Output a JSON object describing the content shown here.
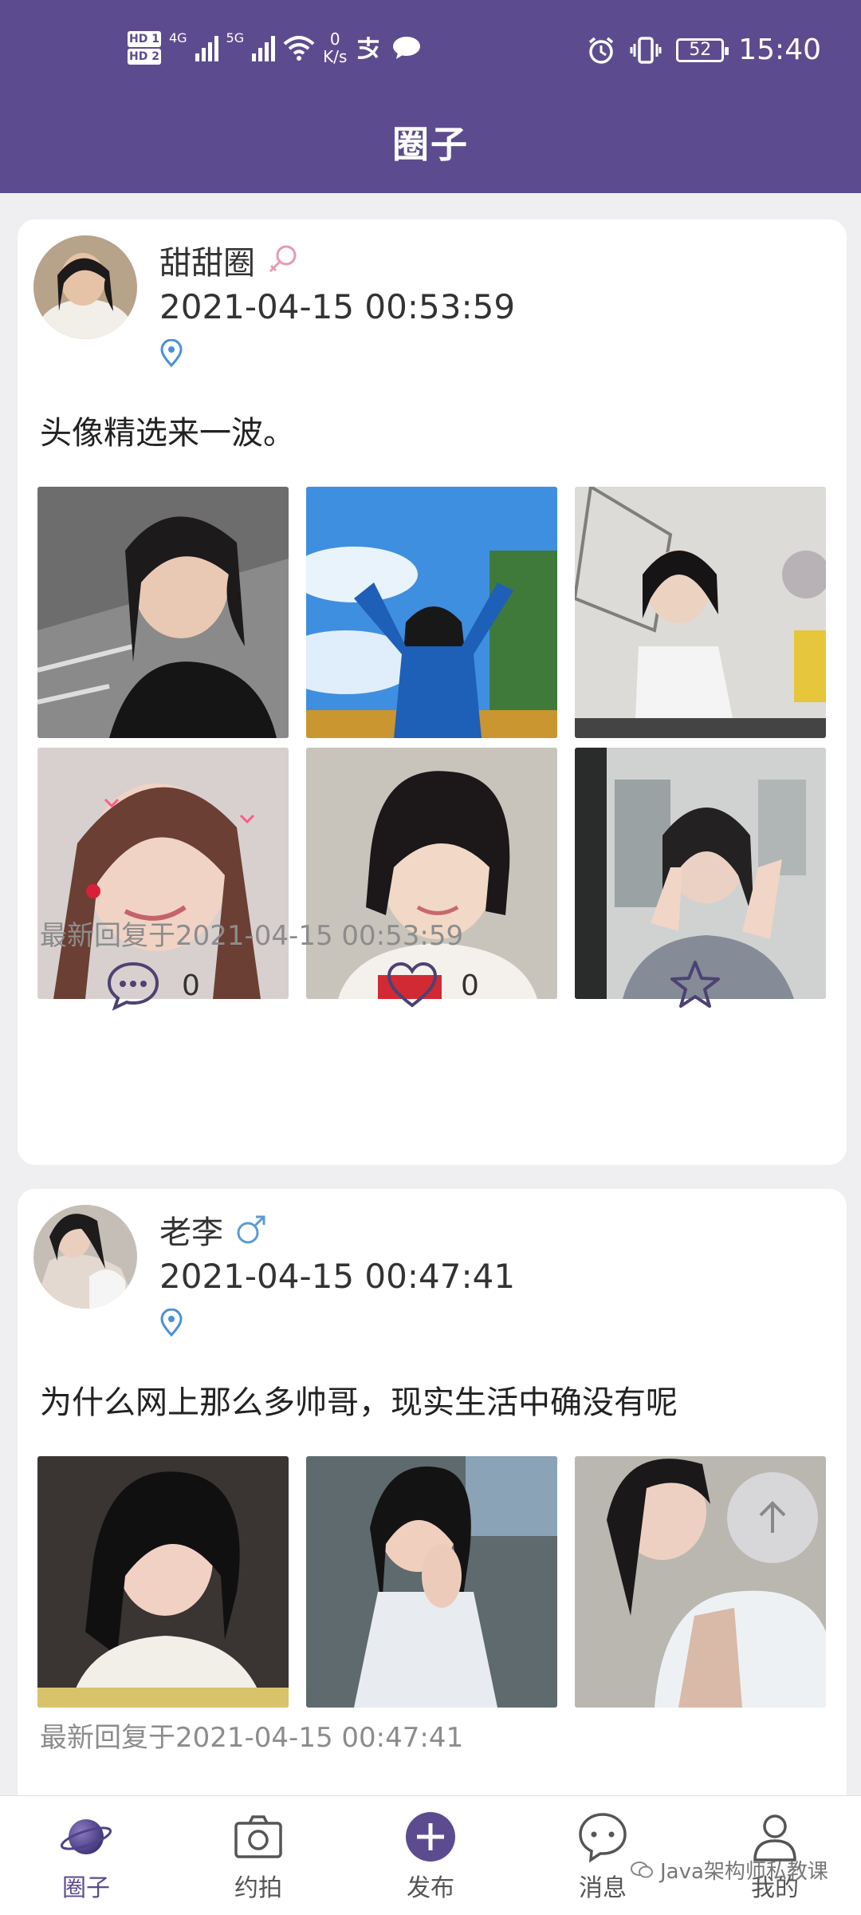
{
  "status_bar": {
    "speed_value": "0",
    "speed_unit": "K/s",
    "battery": "52",
    "time": "15:40",
    "hd1": "HD 1",
    "hd2": "HD 2",
    "net1": "4G",
    "net2": "5G"
  },
  "header": {
    "title": "圈子"
  },
  "posts": [
    {
      "username": "甜甜圈",
      "gender": "female",
      "time": "2021-04-15 00:53:59",
      "text": "头像精选来一波。",
      "reply_time": "最新回复于2021-04-15 00:53:59",
      "comments": "0",
      "likes": "0"
    },
    {
      "username": "老李",
      "gender": "male",
      "time": "2021-04-15 00:47:41",
      "text": "为什么网上那么多帅哥，现实生活中确没有呢",
      "reply_time": "最新回复于2021-04-15 00:47:41",
      "comments": "",
      "likes": ""
    }
  ],
  "tabs": [
    {
      "label": "圈子",
      "icon": "planet-icon",
      "active": true
    },
    {
      "label": "约拍",
      "icon": "camera-icon",
      "active": false
    },
    {
      "label": "发布",
      "icon": "plus-circle-icon",
      "active": false
    },
    {
      "label": "消息",
      "icon": "chat-bubble-icon",
      "active": false
    },
    {
      "label": "我的",
      "icon": "user-icon",
      "active": false
    }
  ],
  "watermark": "Java架构师私教课",
  "colors": {
    "brand": "#5c4c8f",
    "female": "#e79ab0",
    "male": "#5b9bd5"
  }
}
